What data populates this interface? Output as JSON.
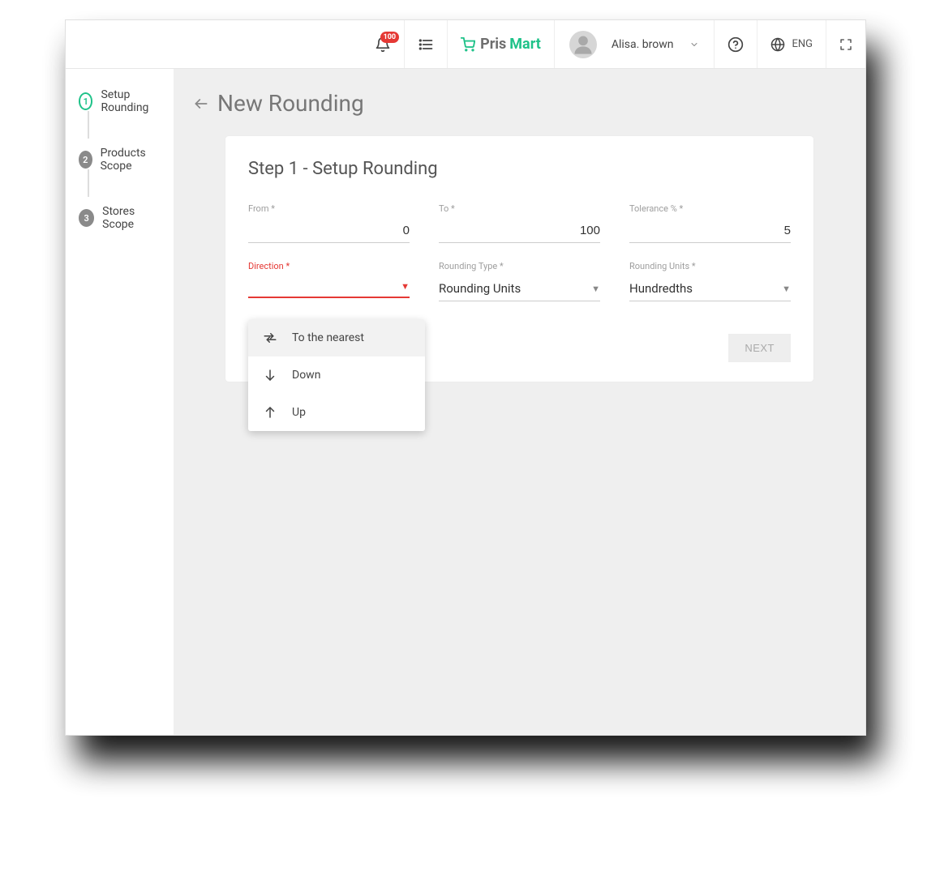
{
  "topbar": {
    "notif_count": "100",
    "brand_part1": "Pris",
    "brand_part2": "Mart",
    "user_name": "Alisa. brown",
    "lang_label": "ENG"
  },
  "sidebar": {
    "steps": [
      {
        "num": "1",
        "label": "Setup Rounding"
      },
      {
        "num": "2",
        "label": "Products Scope"
      },
      {
        "num": "3",
        "label": "Stores Scope"
      }
    ]
  },
  "page": {
    "title": "New Rounding"
  },
  "card": {
    "title": "Step 1 - Setup Rounding",
    "fields": {
      "from": {
        "label": "From *",
        "value": "0"
      },
      "to": {
        "label": "To *",
        "value": "100"
      },
      "tolerance": {
        "label": "Tolerance % *",
        "value": "5"
      },
      "direction": {
        "label": "Direction *",
        "value": ""
      },
      "rounding_type": {
        "label": "Rounding Type *",
        "value": "Rounding Units"
      },
      "rounding_units": {
        "label": "Rounding Units *",
        "value": "Hundredths"
      }
    },
    "next_label": "NEXT"
  },
  "dropdown": {
    "items": [
      {
        "icon": "swap",
        "label": "To the nearest"
      },
      {
        "icon": "down",
        "label": "Down"
      },
      {
        "icon": "up",
        "label": "Up"
      }
    ]
  }
}
